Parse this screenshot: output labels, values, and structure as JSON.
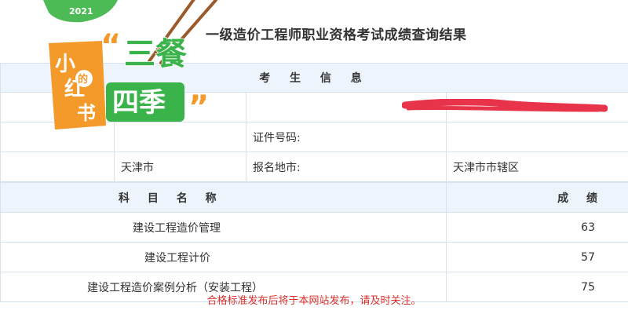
{
  "page": {
    "title": "一级造价工程师职业资格考试成绩查询结果"
  },
  "info_section": {
    "heading": "考 生 信 息",
    "rows": [
      {
        "label1": "",
        "value1": "",
        "label2": "",
        "value2": ""
      },
      {
        "label1": "",
        "value1": "",
        "label2": "证件号码:",
        "value2": ""
      },
      {
        "label1": "",
        "value1": "天津市",
        "label2": "报名地市:",
        "value2": "天津市市辖区"
      }
    ]
  },
  "scores_section": {
    "subject_header": "科 目 名 称",
    "score_header": "成 绩",
    "rows": [
      {
        "subject": "建设工程造价管理",
        "score": "63"
      },
      {
        "subject": "建设工程计价",
        "score": "57"
      },
      {
        "subject": "建设工程造价案例分析（安装工程）",
        "score": "75"
      }
    ]
  },
  "notice": "合格标准发布后将于本网站发布，请及时关注。",
  "sticker": {
    "year": "2021",
    "line1": "小",
    "line2": "红",
    "line3": "书",
    "quote_top": "三餐",
    "quote_bottom": "四季",
    "tag": "的"
  },
  "colors": {
    "header_bg": "#edf4fb",
    "border": "#d6e2ee",
    "notice_red": "#d9302c",
    "sticker_green": "#3ab44a",
    "sticker_orange": "#f39a2b",
    "redaction_red": "#e8344a"
  }
}
